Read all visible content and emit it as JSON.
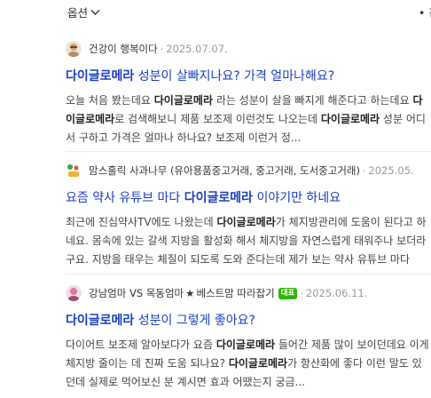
{
  "topbar": {
    "options_label": "옵션",
    "right_fragment": "• 관"
  },
  "posts": [
    {
      "author": "건강이 행복이다",
      "date": "2025.07.07.",
      "title_parts": [
        {
          "t": "다이글로메라",
          "b": true
        },
        {
          "t": " 성분이 살빠지나요? 가격 얼마나해요?",
          "b": false
        }
      ],
      "desc_parts": [
        {
          "t": "오늘 처음 봤는데요 ",
          "b": false
        },
        {
          "t": "다이글로메라",
          "b": true
        },
        {
          "t": " 라는 성분이 살을 빠지게 해준다고 하는데요 ",
          "b": false
        },
        {
          "t": "다이글로메라",
          "b": true
        },
        {
          "t": "로 검색해보니 제품 보조제 이런것도 나오는데 ",
          "b": false
        },
        {
          "t": "다이글로메라",
          "b": true
        },
        {
          "t": " 성분 어디서 구하고 가격은 얼마나 하나요? 보조제 이런거 정...",
          "b": false
        }
      ],
      "avatar_color": "#c9a27c",
      "has_badge": false
    },
    {
      "author": "맘스홀릭 사과나무 (유아용품중고거래, 중고거래, 도서중고거래)",
      "date": "2025.05.",
      "title_parts": [
        {
          "t": "요즘 약사 유튜브 마다 ",
          "b": false
        },
        {
          "t": "다이글로메라",
          "b": true
        },
        {
          "t": " 이야기만 하네요",
          "b": false
        }
      ],
      "desc_parts": [
        {
          "t": "최근에 진심약사TV에도 나왔는데 ",
          "b": false
        },
        {
          "t": "다이글로메라",
          "b": true
        },
        {
          "t": "가 체지방관리에 도움이 된다고 하네요. 몸속에 있는 갈색 지방을 활성화 해서 체지방을 자연스럽게 태워주나 보더라구요. 지방을 태우는 체질이 되도록 도와 준다는데 제가 보는 약사 유튜브 마다",
          "b": false
        }
      ],
      "avatar_color": "#3aa24a",
      "has_badge": false
    },
    {
      "author": "강남엄마 VS 목동엄마",
      "author_star": "★",
      "author_suffix": "베스트맘 따라잡기",
      "badge": "대표",
      "date": "2025.06.11.",
      "title_parts": [
        {
          "t": "다이글로메라",
          "b": true
        },
        {
          "t": " 성분이 그렇게 좋아요?",
          "b": false
        }
      ],
      "desc_parts": [
        {
          "t": "다이어트 보조제 알아보다가 요즘 ",
          "b": false
        },
        {
          "t": "다이글로메라",
          "b": true
        },
        {
          "t": " 들어간 제품 많이 보이던데요 이게 체지방 줄이는 데 진짜 도움 되나요? ",
          "b": false
        },
        {
          "t": "다이글로메라",
          "b": true
        },
        {
          "t": "가 항산화에 좋다 이런 말도 있던데 실제로 먹어보신 분 계시면 효과 어땠는지 궁금...",
          "b": false
        }
      ],
      "avatar_color": "#d27aa0",
      "has_badge": true
    }
  ],
  "colors": {
    "title_link": "#1a3ec2",
    "date": "#999999",
    "badge": "#2db400"
  }
}
